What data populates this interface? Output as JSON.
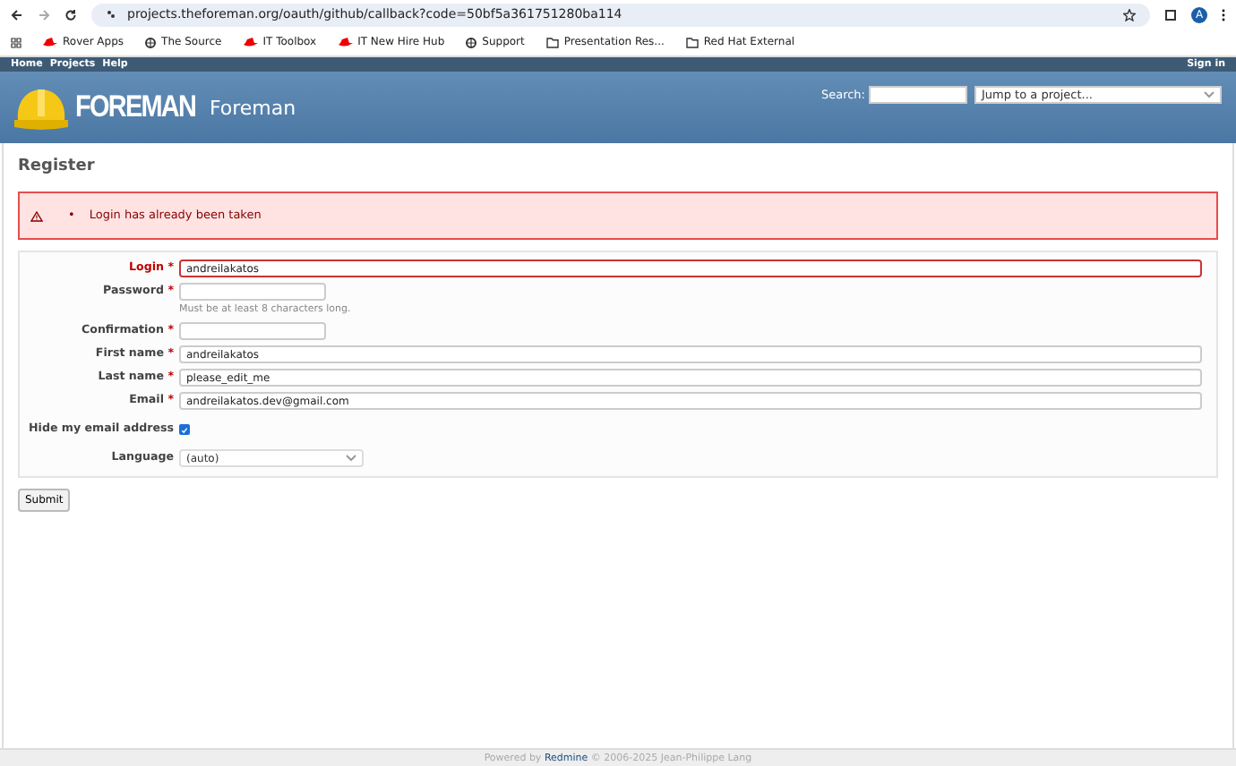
{
  "browser": {
    "url": "projects.theforeman.org/oauth/github/callback?code=50bf5a361751280ba114",
    "avatar": "A",
    "bookmarks": [
      {
        "label": "Rover Apps",
        "kind": "hat"
      },
      {
        "label": "The Source",
        "kind": "globe"
      },
      {
        "label": "IT Toolbox",
        "kind": "hat"
      },
      {
        "label": "IT New Hire Hub",
        "kind": "hat"
      },
      {
        "label": "Support",
        "kind": "globe"
      },
      {
        "label": "Presentation Res...",
        "kind": "folder"
      },
      {
        "label": "Red Hat External",
        "kind": "folder"
      }
    ]
  },
  "top_menu": {
    "items": [
      "Home",
      "Projects",
      "Help"
    ],
    "sign_in": "Sign in"
  },
  "header": {
    "logo_text": "FOREMAN",
    "title": "Foreman",
    "search_label": "Search:",
    "jump_placeholder": "Jump to a project..."
  },
  "page_title": "Register",
  "error_bullet": "•",
  "errors": [
    "Login has already been taken"
  ],
  "required_marker": "*",
  "fields": [
    {
      "kind": "text",
      "label": "Login",
      "required": true,
      "error": true,
      "value": "andreilakatos"
    },
    {
      "kind": "password",
      "label": "Password",
      "required": true,
      "error": false,
      "hint": "Must be at least 8 characters long."
    },
    {
      "kind": "password",
      "label": "Confirmation",
      "required": true,
      "error": false
    },
    {
      "kind": "text",
      "label": "First name",
      "required": true,
      "error": false,
      "value": "andreilakatos"
    },
    {
      "kind": "text",
      "label": "Last name",
      "required": true,
      "error": false,
      "value": "please_edit_me"
    },
    {
      "kind": "text",
      "label": "Email",
      "required": true,
      "error": false,
      "value": "andreilakatos.dev@gmail.com"
    },
    {
      "kind": "checkbox",
      "label": "Hide my email address",
      "required": false,
      "error": false,
      "checked": true
    },
    {
      "kind": "select",
      "label": "Language",
      "required": false,
      "error": false,
      "value": "(auto)"
    }
  ],
  "submit": "Submit",
  "footer": {
    "prefix": "Powered by",
    "link": "Redmine",
    "suffix": "© 2006-2025 Jean-Philippe Lang"
  }
}
